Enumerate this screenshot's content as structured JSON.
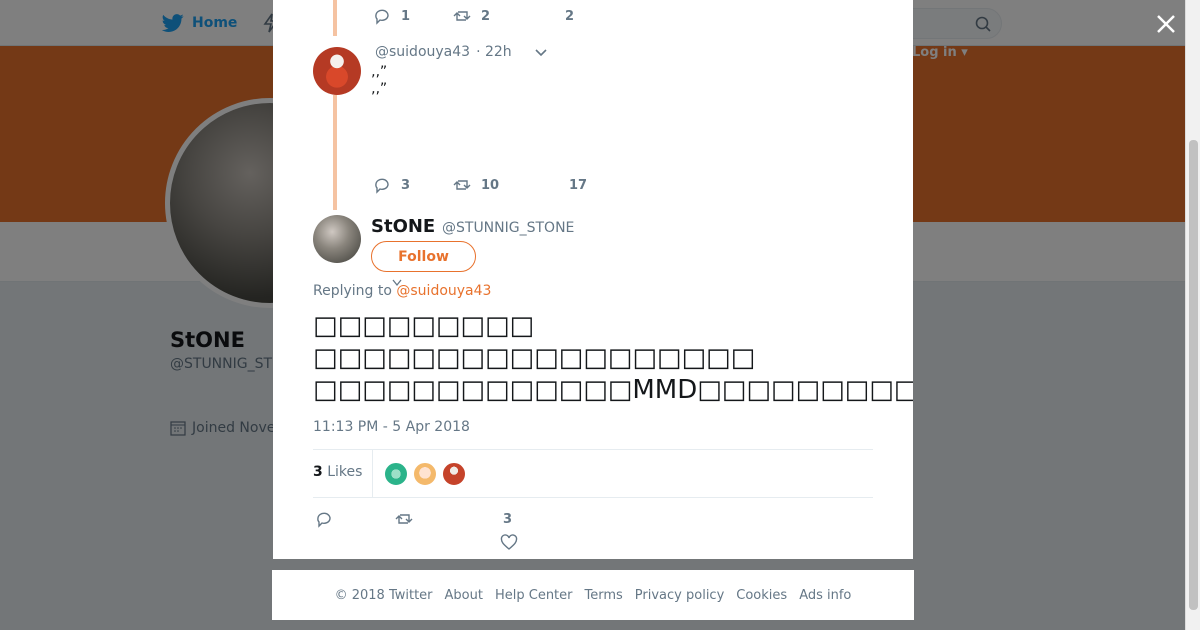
{
  "topbar": {
    "home_label": "Home",
    "login_label": "Log in ▾"
  },
  "profile": {
    "name": "StONE",
    "handle": "@STUNNIG_ST",
    "joined": "Joined Nove"
  },
  "modal": {
    "prev_tweet_actions": {
      "replies": "1",
      "retweets": "2",
      "likes": "2"
    },
    "quoted": {
      "handle": "@suidouya43",
      "time": "· 22h",
      "text": "‚‚”\n‚‚”",
      "actions": {
        "replies": "3",
        "retweets": "10",
        "likes": "17"
      }
    },
    "main_tweet": {
      "name": "StONE",
      "handle": "@STUNNIG_STONE",
      "follow_label": "Follow",
      "replying_prefix": "Replying to",
      "replying_to": "@suidouya43",
      "text_lines": [
        "□□□□□□□□□",
        "□□□□□□□□□□□□□□□□□□",
        "□□□□□□□□□□□□□MMD□□□□□□□□□□□□□"
      ],
      "timestamp": "11:13 PM - 5 Apr 2018",
      "likes_count": "3",
      "likes_label": "Likes",
      "bottom_like_count": "3"
    }
  },
  "footer": {
    "items": [
      "© 2018 Twitter",
      "About",
      "Help Center",
      "Terms",
      "Privacy policy",
      "Cookies",
      "Ads info"
    ]
  },
  "colors": {
    "accent": "#e8722d",
    "twitter_blue": "#1da1f2",
    "muted": "#657786",
    "thread_line": "#f5c3a2"
  }
}
